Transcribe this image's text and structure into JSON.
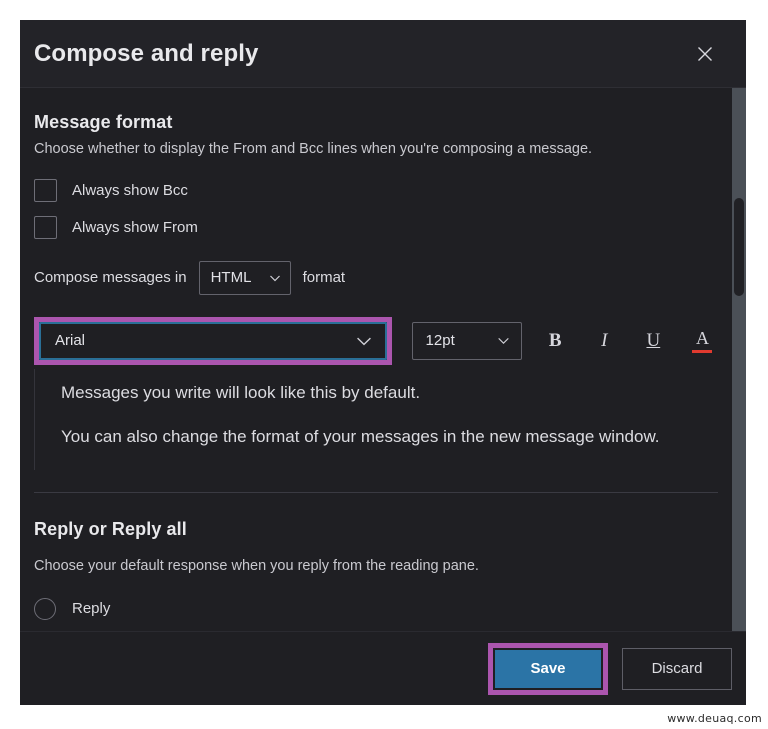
{
  "dialog": {
    "title": "Compose and reply",
    "close_icon": "close-icon"
  },
  "message_format": {
    "heading": "Message format",
    "description": "Choose whether to display the From and Bcc lines when you're composing a message.",
    "checkboxes": [
      {
        "label": "Always show Bcc",
        "checked": false
      },
      {
        "label": "Always show From",
        "checked": false
      }
    ],
    "compose_prefix": "Compose messages in",
    "compose_format_value": "HTML",
    "compose_suffix": "format"
  },
  "font_toolbar": {
    "font_value": "Arial",
    "size_value": "12pt",
    "bold_label": "B",
    "italic_label": "I",
    "underline_label": "U",
    "font_color_label": "A",
    "font_color_swatch": "#e03a2f",
    "highlight_color": "#ab55ae",
    "focus_border_color": "#2a6f97"
  },
  "preview": {
    "line1": "Messages you write will look like this by default.",
    "line2": "You can also change the format of your messages in the new message window."
  },
  "reply_section": {
    "heading": "Reply or Reply all",
    "description": "Choose your default response when you reply from the reading pane.",
    "options": [
      {
        "label": "Reply",
        "selected": false
      }
    ]
  },
  "footer": {
    "save_label": "Save",
    "discard_label": "Discard",
    "save_color": "#2b74a6",
    "save_highlight_color": "#ab55ae"
  },
  "watermark": {
    "text": "www.deuaq.com"
  }
}
